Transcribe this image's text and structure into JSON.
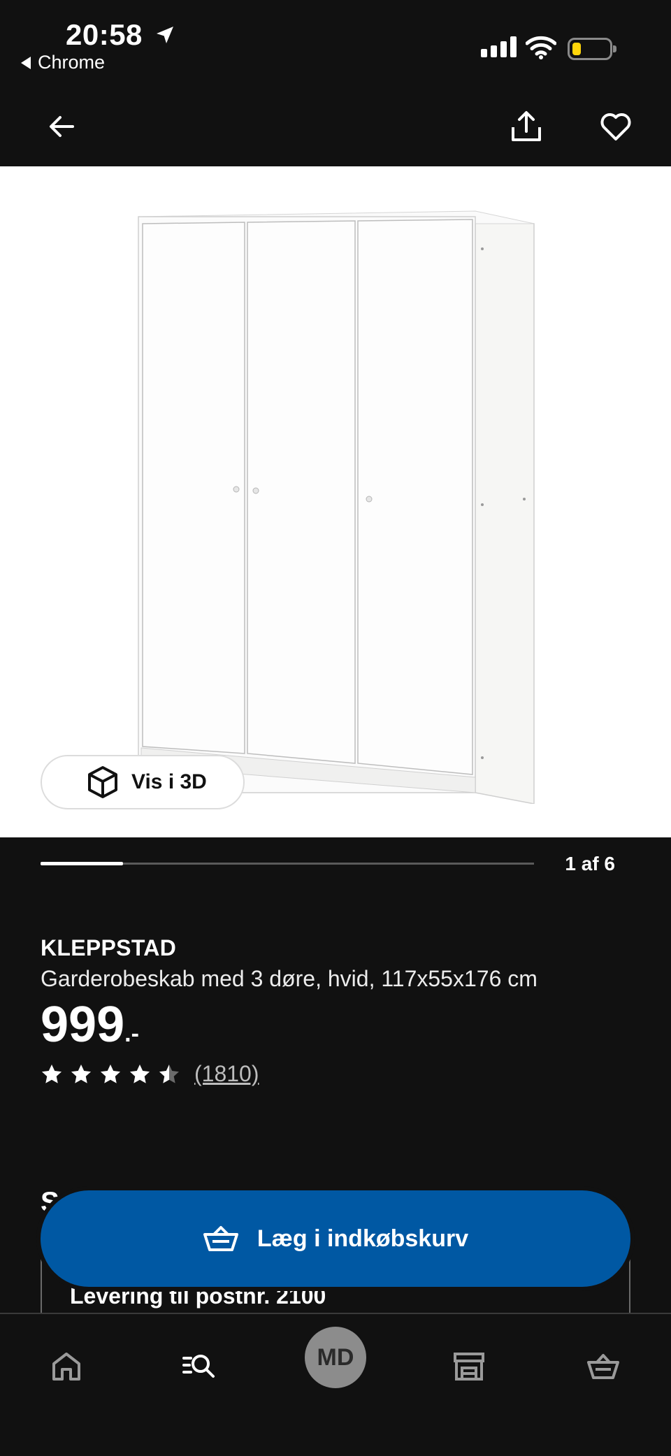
{
  "status_bar": {
    "time": "20:58",
    "back_app": "Chrome",
    "battery_color": "#ffd60a"
  },
  "header": {
    "back_icon": "arrow-left-icon",
    "share_icon": "share-icon",
    "favorite_icon": "heart-icon"
  },
  "gallery": {
    "view_3d_label": "Vis i 3D",
    "page_indicator": "1 af 6",
    "current_page": 1,
    "total_pages": 6
  },
  "product": {
    "name": "KLEPPSTAD",
    "description": "Garderobeskab med 3 døre, hvid, 117x55x176 cm",
    "price": "999",
    "price_suffix": ".-",
    "rating": 4.5,
    "review_count": "(1810)"
  },
  "delivery": {
    "section_title": "S",
    "label": "Levering til postnr. 2100"
  },
  "actions": {
    "add_to_cart_label": "Læg i indkøbskurv",
    "add_to_cart_color": "#0058a3"
  },
  "tab_bar": {
    "home_icon": "home-icon",
    "search_icon": "search-list-icon",
    "avatar_initials": "MD",
    "store_icon": "store-icon",
    "cart_icon": "basket-icon"
  }
}
